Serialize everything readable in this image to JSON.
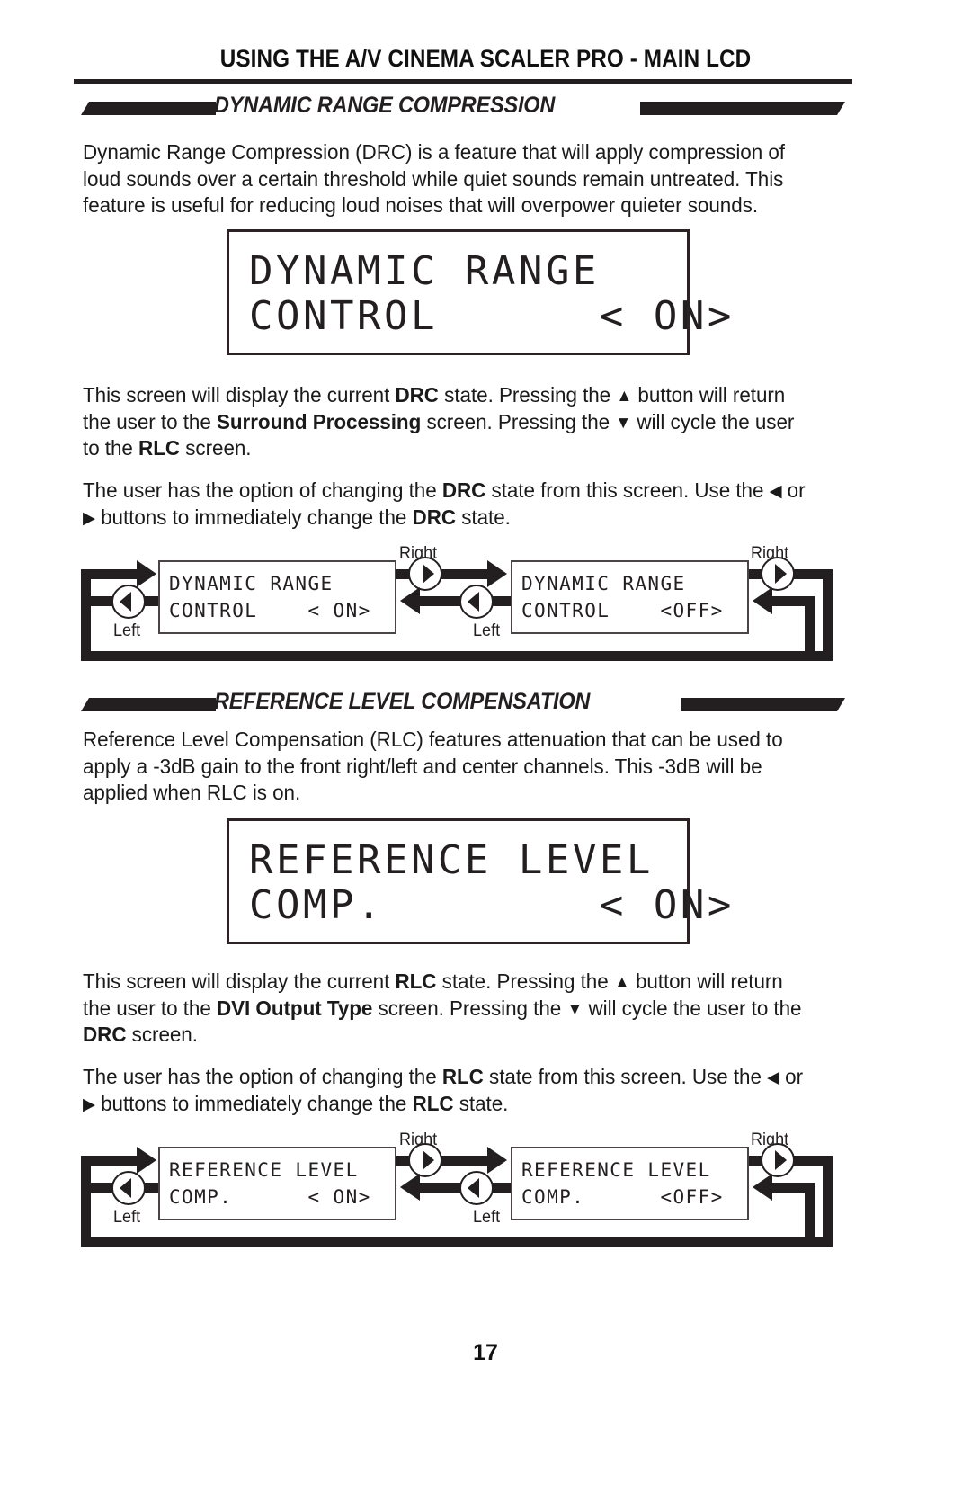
{
  "header": {
    "title": "USING THE A/V CINEMA SCALER PRO - MAIN LCD"
  },
  "sections": [
    {
      "banner_title": "DYNAMIC RANGE COMPRESSION",
      "intro_paragraph": "Dynamic Range Compression (DRC) is a feature that will apply compression of loud sounds over a certain threshold while quiet sounds remain untreated. This feature is useful for reducing loud noises that will overpower quieter sounds.",
      "lcd": {
        "line1": "DYNAMIC RANGE",
        "line2": "CONTROL      < ON>"
      },
      "nav_paragraph": {
        "p1": "This screen will display the current ",
        "b1": "DRC",
        "p2": " state. Pressing the ",
        "up_arrow": "▲",
        "p3": " button will return the user to the ",
        "b2": "Surround Processing",
        "p4": "  screen. Pressing the ",
        "down_arrow": "▼",
        "p5": " will cycle the user to the ",
        "b3": "RLC",
        "p6": " screen."
      },
      "change_paragraph": {
        "p1": "The user has the option of changing the ",
        "b1": "DRC",
        "p2": " state from this screen. Use the ",
        "left_arrow": "◀",
        "p3": " or ",
        "right_arrow": "▶",
        "p4": " buttons to immediately change the ",
        "b2": "DRC",
        "p5": " state."
      },
      "diagram": {
        "state_on": {
          "line1": "DYNAMIC RANGE",
          "line2": "CONTROL    < ON>"
        },
        "state_off": {
          "line1": "DYNAMIC RANGE",
          "line2": "CONTROL    <OFF>"
        },
        "label_right_1": "Right",
        "label_right_2": "Right",
        "label_left_1": "Left",
        "label_left_2": "Left"
      }
    },
    {
      "banner_title": "REFERENCE LEVEL COMPENSATION",
      "intro_paragraph": "Reference Level Compensation (RLC) features attenuation that can be used to apply a -3dB gain to the front right/left and center channels. This -3dB will be applied when RLC is on.",
      "lcd": {
        "line1": "REFERENCE LEVEL",
        "line2": "COMP.        < ON>"
      },
      "nav_paragraph": {
        "p1": "This screen will display the current ",
        "b1": "RLC",
        "p2": " state. Pressing the ",
        "up_arrow": "▲",
        "p3": " button will return the user to the ",
        "b2": "DVI Output Type",
        "p4": "  screen. Pressing the ",
        "down_arrow": "▼",
        "p5": " will cycle the user to the ",
        "b3": "DRC",
        "p6": " screen."
      },
      "change_paragraph": {
        "p1": "The user has the option of changing the ",
        "b1": "RLC",
        "p2": " state from this screen. Use the ",
        "left_arrow": "◀",
        "p3": " or ",
        "right_arrow": "▶",
        "p4": " buttons to immediately change the ",
        "b2": "RLC",
        "p5": " state."
      },
      "diagram": {
        "state_on": {
          "line1": "REFERENCE LEVEL",
          "line2": "COMP.      < ON>"
        },
        "state_off": {
          "line1": "REFERENCE LEVEL",
          "line2": "COMP.      <OFF>"
        },
        "label_right_1": "Right",
        "label_right_2": "Right",
        "label_left_1": "Left",
        "label_left_2": "Left"
      }
    }
  ],
  "footer": {
    "page_number": "17"
  },
  "colors": {
    "ink": "#231f20",
    "paper": "#ffffff"
  }
}
